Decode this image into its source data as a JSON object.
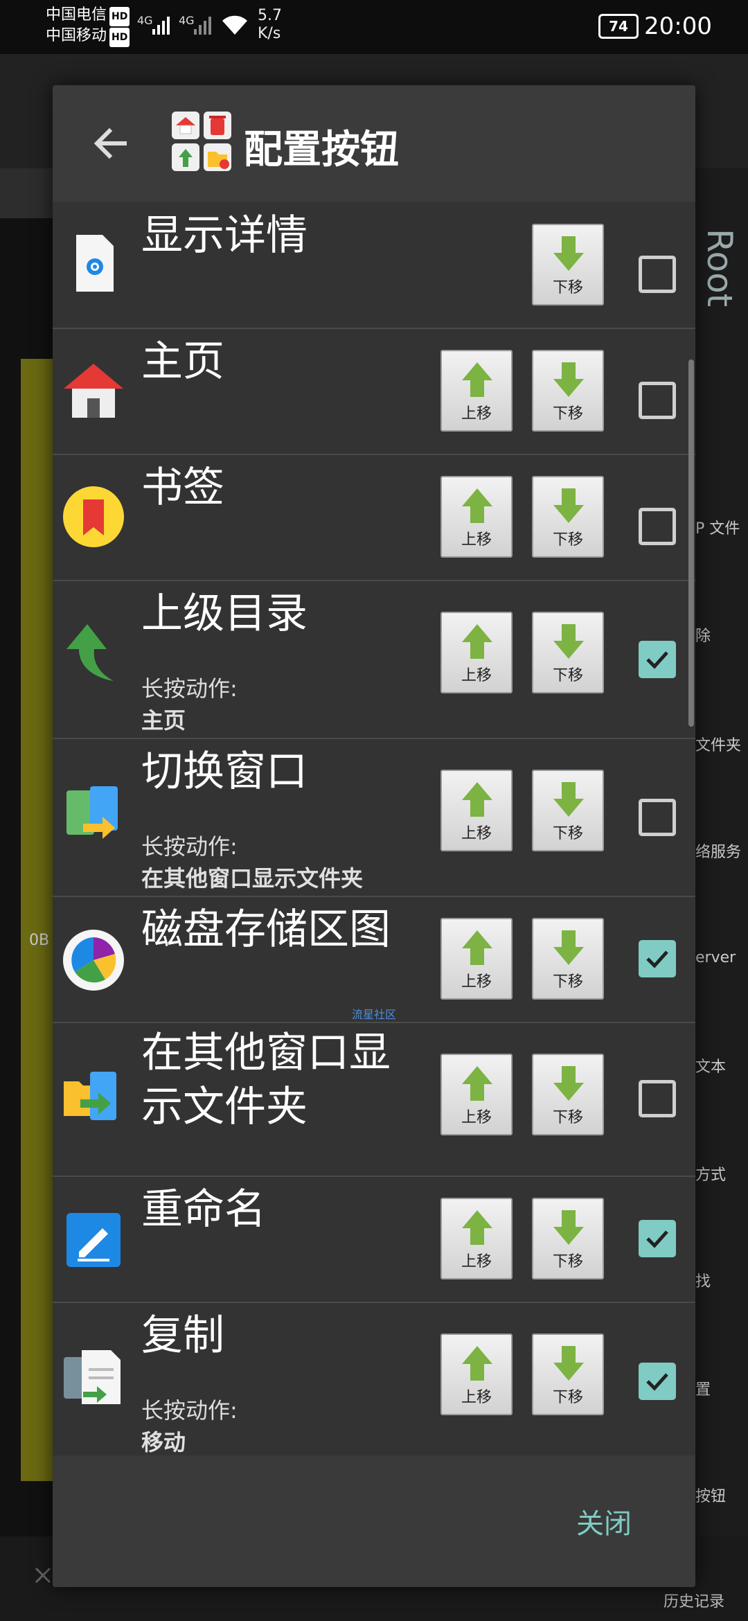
{
  "status": {
    "carrier1": "中国电信",
    "carrier2": "中国移动",
    "hd": "HD",
    "net": "4G",
    "speed_value": "5.7",
    "speed_unit": "K/s",
    "battery": "74",
    "time": "20:00"
  },
  "background": {
    "root_text": "Root",
    "side_labels": [
      "P 文件",
      "除",
      "文件夹",
      "络服务",
      "erver",
      "文本",
      "方式",
      "找",
      "置",
      "按钮",
      "历史记录"
    ],
    "left_text": "0B"
  },
  "dialog": {
    "title": "配置按钮",
    "close_label": "关闭",
    "up_label": "上移",
    "down_label": "下移",
    "long_press_label": "长按动作:",
    "watermark": "流星社区",
    "rows": [
      {
        "label": "显示详情",
        "icon": "file-info-icon",
        "checked": false,
        "long": ""
      },
      {
        "label": "主页",
        "icon": "home-icon",
        "checked": false,
        "long": ""
      },
      {
        "label": "书签",
        "icon": "bookmark-icon",
        "checked": false,
        "long": ""
      },
      {
        "label": "上级目录",
        "icon": "up-arrow-icon",
        "checked": true,
        "long": "主页"
      },
      {
        "label": "切换窗口",
        "icon": "switch-window-icon",
        "checked": false,
        "long": "在其他窗口显示文件夹"
      },
      {
        "label": "磁盘存储区图",
        "icon": "disk-chart-icon",
        "checked": true,
        "long": ""
      },
      {
        "label": "在其他窗口显\n示文件夹",
        "icon": "folder-other-window-icon",
        "checked": false,
        "long": ""
      },
      {
        "label": "重命名",
        "icon": "rename-icon",
        "checked": true,
        "long": ""
      },
      {
        "label": "复制",
        "icon": "copy-icon",
        "checked": true,
        "long": "移动"
      }
    ]
  }
}
